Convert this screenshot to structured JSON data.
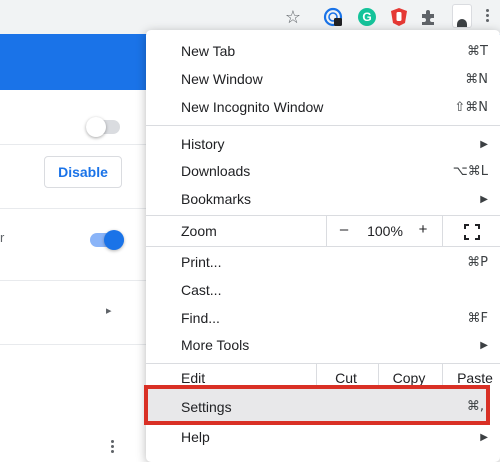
{
  "colors": {
    "accent": "#1a73e8",
    "highlight_border": "#d93025"
  },
  "toolbar": {
    "icons": [
      "star-icon",
      "reader-extension-icon",
      "grammarly-icon",
      "red-extension-icon",
      "puzzle-icon",
      "profile-icon",
      "more-vert-icon"
    ],
    "grammarly_letter": "G"
  },
  "page": {
    "disable_label": "Disable",
    "side_text": "r"
  },
  "menu": {
    "new_tab": {
      "label": "New Tab",
      "shortcut": "⌘T"
    },
    "new_window": {
      "label": "New Window",
      "shortcut": "⌘N"
    },
    "incognito": {
      "label": "New Incognito Window",
      "shortcut": "⇧⌘N"
    },
    "history": {
      "label": "History"
    },
    "downloads": {
      "label": "Downloads",
      "shortcut": "⌥⌘L"
    },
    "bookmarks": {
      "label": "Bookmarks"
    },
    "zoom": {
      "label": "Zoom",
      "minus": "–",
      "value": "100%",
      "plus": "+"
    },
    "print": {
      "label": "Print...",
      "shortcut": "⌘P"
    },
    "cast": {
      "label": "Cast..."
    },
    "find": {
      "label": "Find...",
      "shortcut": "⌘F"
    },
    "more_tools": {
      "label": "More Tools"
    },
    "edit": {
      "label": "Edit",
      "cut": "Cut",
      "copy": "Copy",
      "paste": "Paste"
    },
    "settings": {
      "label": "Settings",
      "shortcut": "⌘,"
    },
    "help": {
      "label": "Help"
    }
  }
}
